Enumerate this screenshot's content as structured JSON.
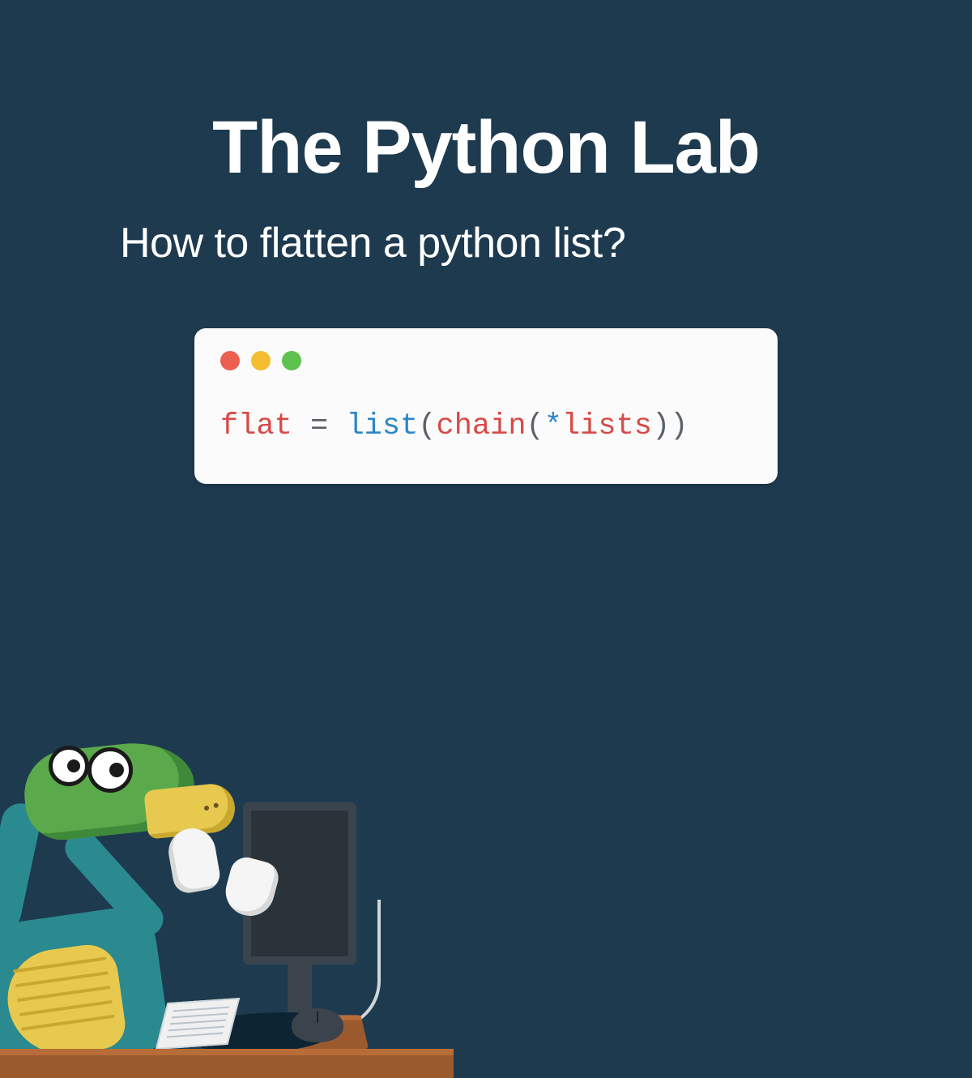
{
  "header": {
    "title": "The Python Lab",
    "subtitle": "How to flatten a python list?"
  },
  "traffic_lights": {
    "red": "close-icon",
    "yellow": "minimize-icon",
    "green": "maximize-icon"
  },
  "code": {
    "tokens": {
      "t1": "flat",
      "t2": " = ",
      "t3": "list",
      "t4": "(",
      "t5": "chain",
      "t6": "(",
      "t7": "*",
      "t8": "lists",
      "t9": "))"
    }
  },
  "illustration": {
    "name": "python-snake-at-computer"
  }
}
